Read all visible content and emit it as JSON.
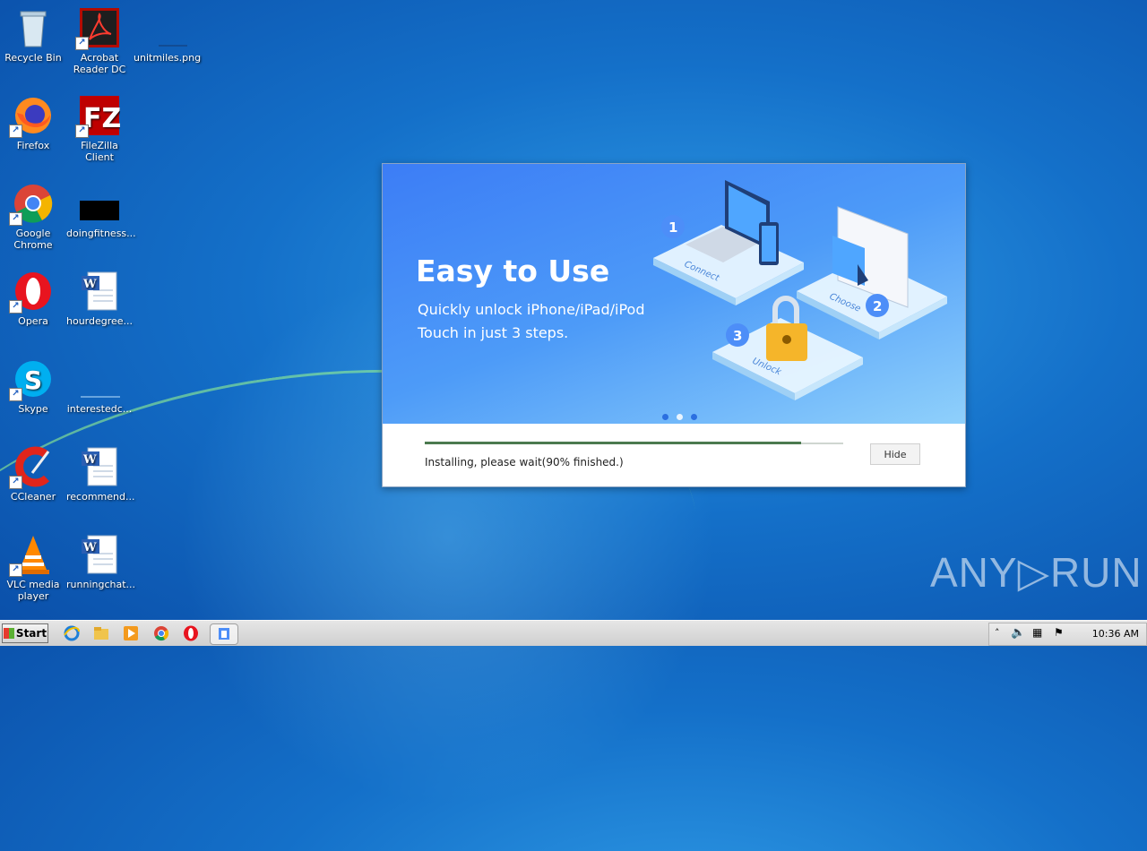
{
  "desktop": {
    "icons": [
      {
        "label": "Recycle Bin"
      },
      {
        "label": "Acrobat Reader DC"
      },
      {
        "label": "unitmiles.png"
      },
      {
        "label": "Firefox"
      },
      {
        "label": "FileZilla Client"
      },
      {
        "label": "Google Chrome"
      },
      {
        "label": "doingfitness..."
      },
      {
        "label": "Opera"
      },
      {
        "label": "hourdegree..."
      },
      {
        "label": "Skype"
      },
      {
        "label": "interestedc..."
      },
      {
        "label": "CCleaner"
      },
      {
        "label": "recommend..."
      },
      {
        "label": "VLC media player"
      },
      {
        "label": "runningchat..."
      }
    ]
  },
  "installer": {
    "banner_title": "Easy to Use",
    "banner_subtitle": "Quickly unlock iPhone/iPad/iPod Touch in just 3 steps.",
    "steps": [
      {
        "number": "1",
        "label": "Connect"
      },
      {
        "number": "2",
        "label": "Choose"
      },
      {
        "number": "3",
        "label": "Unlock"
      }
    ],
    "carousel_active_index": 1,
    "progress_percent": 90,
    "status_text": "Installing, please wait(90% finished.)",
    "hide_label": "Hide"
  },
  "taskbar": {
    "start_label": "Start",
    "clock": "10:36 AM"
  },
  "watermark": "ANY▷RUN"
}
